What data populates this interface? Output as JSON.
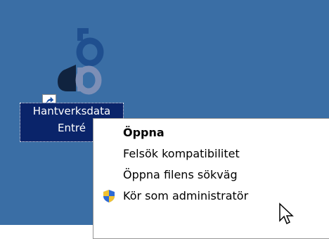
{
  "desktop": {
    "background_color": "#3a6ea5",
    "shortcut": {
      "label_line1": "Hantverksdata",
      "label_line2": "Entré",
      "icon": "hantverksdata-logo-icon",
      "overlay_icon": "shortcut-arrow-icon"
    }
  },
  "context_menu": {
    "items": [
      {
        "label": "Öppna",
        "bold": true
      },
      {
        "label": "Felsök kompatibilitet"
      },
      {
        "label": "Öppna filens sökväg"
      },
      {
        "label": "Kör som administratör",
        "icon": "uac-shield-icon"
      }
    ]
  },
  "pointer": {
    "icon": "mouse-cursor-icon"
  }
}
